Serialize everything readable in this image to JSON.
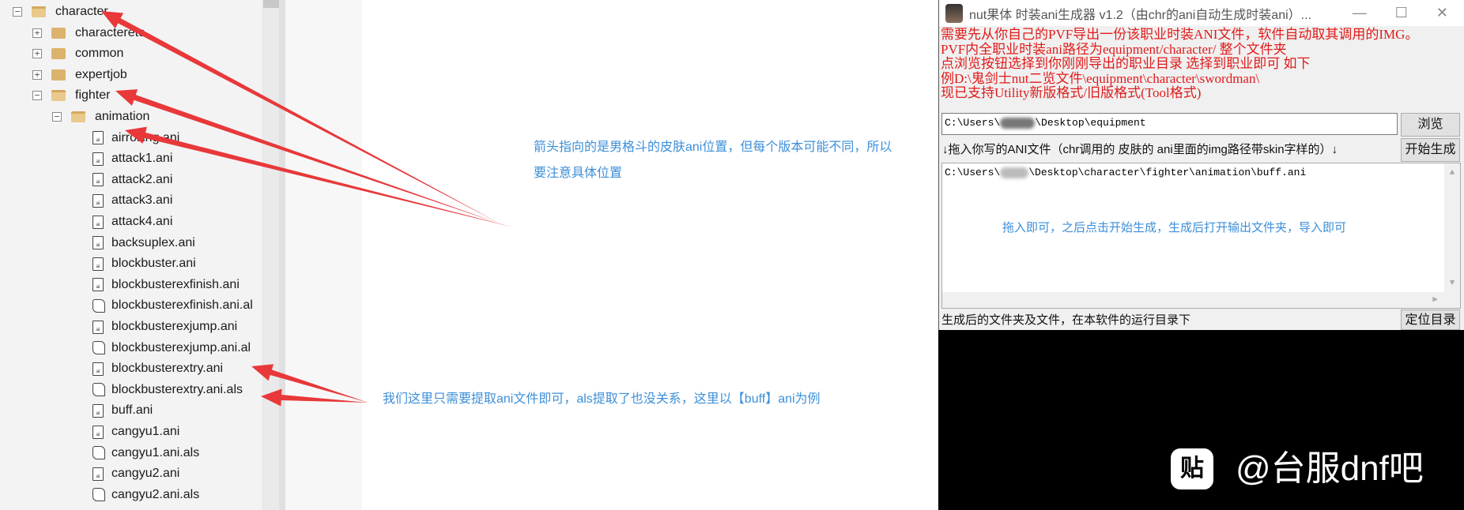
{
  "tree": {
    "items": [
      {
        "label": "character",
        "level": 0,
        "type": "folder-open",
        "expander": "minus"
      },
      {
        "label": "characteretc",
        "level": 1,
        "type": "folder",
        "expander": "plus"
      },
      {
        "label": "common",
        "level": 1,
        "type": "folder",
        "expander": "plus"
      },
      {
        "label": "expertjob",
        "level": 1,
        "type": "folder",
        "expander": "plus"
      },
      {
        "label": "fighter",
        "level": 1,
        "type": "folder-open",
        "expander": "minus"
      },
      {
        "label": "animation",
        "level": 2,
        "type": "folder-open",
        "expander": "minus"
      },
      {
        "label": "airrolling.ani",
        "level": 3,
        "type": "ani"
      },
      {
        "label": "attack1.ani",
        "level": 3,
        "type": "ani"
      },
      {
        "label": "attack2.ani",
        "level": 3,
        "type": "ani"
      },
      {
        "label": "attack3.ani",
        "level": 3,
        "type": "ani"
      },
      {
        "label": "attack4.ani",
        "level": 3,
        "type": "ani"
      },
      {
        "label": "backsuplex.ani",
        "level": 3,
        "type": "ani"
      },
      {
        "label": "blockbuster.ani",
        "level": 3,
        "type": "ani"
      },
      {
        "label": "blockbusterexfinish.ani",
        "level": 3,
        "type": "ani"
      },
      {
        "label": "blockbusterexfinish.ani.al",
        "level": 3,
        "type": "als"
      },
      {
        "label": "blockbusterexjump.ani",
        "level": 3,
        "type": "ani"
      },
      {
        "label": "blockbusterexjump.ani.al",
        "level": 3,
        "type": "als"
      },
      {
        "label": "blockbusterextry.ani",
        "level": 3,
        "type": "ani"
      },
      {
        "label": "blockbusterextry.ani.als",
        "level": 3,
        "type": "als"
      },
      {
        "label": "buff.ani",
        "level": 3,
        "type": "ani"
      },
      {
        "label": "cangyu1.ani",
        "level": 3,
        "type": "ani"
      },
      {
        "label": "cangyu1.ani.als",
        "level": 3,
        "type": "als"
      },
      {
        "label": "cangyu2.ani",
        "level": 3,
        "type": "ani"
      },
      {
        "label": "cangyu2.ani.als",
        "level": 3,
        "type": "als"
      }
    ]
  },
  "annotations": {
    "top_line1": "箭头指向的是男格斗的皮肤ani位置，但每个版本可能不同，所以",
    "top_line2": "要注意具体位置",
    "bottom": "我们这里只需要提取ani文件即可，als提取了也没关系，这里以【buff】ani为例",
    "arrow_color": "#e8383a"
  },
  "app": {
    "title": "nut果体 时装ani生成器 v1.2（由chr的ani自动生成时装ani）...",
    "instructions": [
      "需要先从你自己的PVF导出一份该职业时装ANI文件，软件自动取其调用的IMG。",
      "PVF内全职业时装ani路径为equipment/character/ 整个文件夹",
      "点浏览按钮选择到你刚刚导出的职业目录 选择到职业即可 如下",
      "例D:\\鬼剑士nut二览文件\\equipment\\character\\swordman\\",
      "现已支持Utility新版格式/旧版格式(Tool格式)"
    ],
    "path_prefix": "C:\\Users\\",
    "path_suffix": "\\Desktop\\equipment",
    "browse_label": "浏览",
    "drag_label": "↓拖入你写的ANI文件（chr调用的 皮肤的 ani里面的img路径带skin字样的）↓",
    "start_label": "开始生成",
    "file_prefix": "C:\\Users\\",
    "file_suffix": "\\Desktop\\character\\fighter\\animation\\buff.ani",
    "hint": "拖入即可，之后点击开始生成，生成后打开输出文件夹，导入即可",
    "status": "生成后的文件夹及文件，在本软件的运行目录下",
    "locate_label": "定位目录"
  },
  "watermark": {
    "icon_text": "贴",
    "text": "@台服dnf吧"
  }
}
